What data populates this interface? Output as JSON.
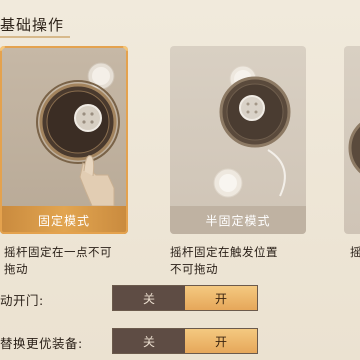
{
  "section": {
    "title": "基础操作"
  },
  "modes": [
    {
      "name": "固定模式",
      "selected": true,
      "description": [
        "摇杆固定在一点不可",
        "拖动"
      ]
    },
    {
      "name": "半固定模式",
      "selected": false,
      "description": [
        "摇杆固定在触发位置",
        "不可拖动"
      ]
    },
    {
      "name": "",
      "selected": false,
      "description": [
        "摇"
      ]
    }
  ],
  "settings": [
    {
      "label": "动开门:",
      "off_label": "关",
      "on_label": "开",
      "value": "on"
    },
    {
      "label": "替换更优装备:",
      "off_label": "关",
      "on_label": "开",
      "value": "on"
    }
  ],
  "colors": {
    "accent": "#e4a24e",
    "toggle_off_bg": "#5e4c44",
    "page_bg": "#ece4d4"
  }
}
